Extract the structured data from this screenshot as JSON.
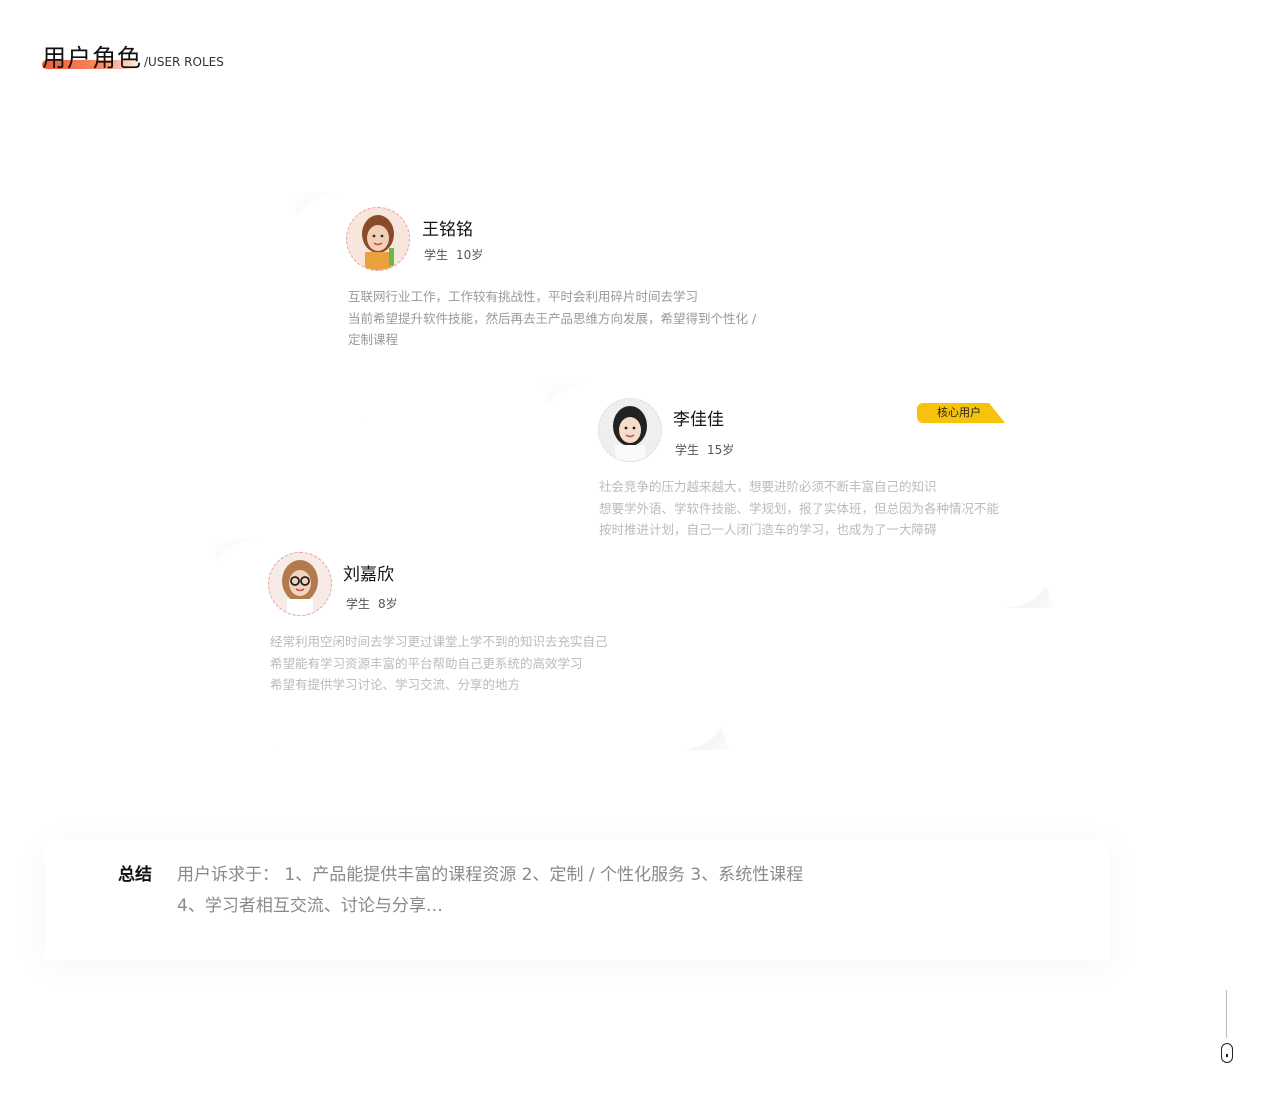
{
  "header": {
    "title": "用户角色",
    "subtitle": "/USER ROLES"
  },
  "personas": [
    {
      "name": "王铭铭",
      "role": "学生",
      "age": "10岁",
      "lines": [
        "互联网行业工作，工作较有挑战性，平时会利用碎片时间去学习",
        "当前希望提升软件技能，然后再去王产品思维方向发展，希望得到个性化 /",
        "定制课程"
      ]
    },
    {
      "name": "李佳佳",
      "role": "学生",
      "age": "15岁",
      "badge": "核心用户",
      "lines": [
        "社会竞争的压力越来越大，想要进阶必须不断丰富自己的知识",
        "想要学外语、学软件技能、学规划，报了实体班，但总因为各种情况不能",
        "按时推进计划，自己一人闭门造车的学习，也成为了一大障碍"
      ]
    },
    {
      "name": "刘嘉欣",
      "role": "学生",
      "age": "8岁",
      "lines": [
        "经常利用空闲时间去学习更过课堂上学不到的知识去充实自己",
        "希望能有学习资源丰富的平台帮助自己更系统的高效学习",
        "希望有提供学习讨论、学习交流、分享的地方"
      ]
    }
  ],
  "summary": {
    "label": "总结",
    "line1": "用户诉求于： 1、产品能提供丰富的课程资源    2、定制 / 个性化服务    3、系统性课程",
    "line2": "4、学习者相互交流、讨论与分享…"
  },
  "colors": {
    "accent": "#f15a3c",
    "badge": "#f6c20c"
  },
  "icons": {
    "scroll": "mouse-scroll-icon"
  }
}
